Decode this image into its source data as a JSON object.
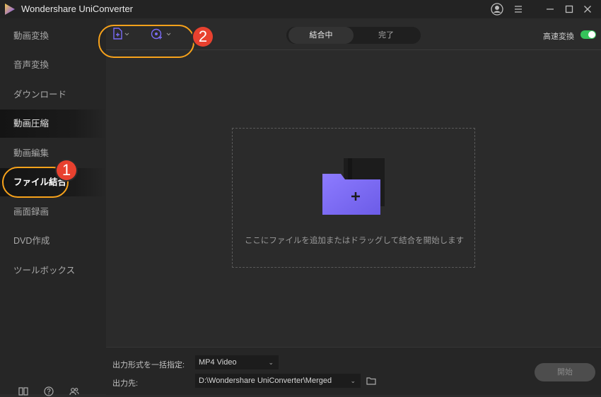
{
  "app": {
    "title": "Wondershare UniConverter",
    "accent": "#7b6cf6"
  },
  "window_controls": {
    "account_icon": "user-circle-icon",
    "menu_icon": "menu-icon",
    "minimize_icon": "minimize-icon",
    "maximize_icon": "maximize-icon",
    "close_icon": "close-icon"
  },
  "sidebar": {
    "items": [
      {
        "label": "動画変換"
      },
      {
        "label": "音声変換"
      },
      {
        "label": "ダウンロード"
      },
      {
        "label": "動画圧縮"
      },
      {
        "label": "動画編集"
      },
      {
        "label": "ファイル結合",
        "active": true
      },
      {
        "label": "画面録画"
      },
      {
        "label": "DVD作成"
      },
      {
        "label": "ツールボックス"
      }
    ],
    "bottom_icons": [
      "book-icon",
      "help-icon",
      "users-icon"
    ]
  },
  "toolbar": {
    "add_file_icon": "add-file-icon",
    "add_media_icon": "add-media-icon",
    "tabs": [
      {
        "label": "結合中",
        "active": true
      },
      {
        "label": "完了",
        "active": false
      }
    ],
    "speed_label": "高速変換",
    "speed_enabled": true,
    "toggle_color": "#35c25a"
  },
  "dropzone": {
    "text": "ここにファイルを追加またはドラッグして結合を開始します",
    "icon": "add-folder-icon"
  },
  "bottom": {
    "format_label": "出力形式を一括指定:",
    "format_value": "MP4 Video",
    "output_label": "出力先:",
    "output_value": "D:\\Wondershare UniConverter\\Merged",
    "start_label": "開始"
  },
  "callouts": [
    "1",
    "2"
  ],
  "callout_color": "#f7a21b",
  "badge_color": "#e8412f"
}
